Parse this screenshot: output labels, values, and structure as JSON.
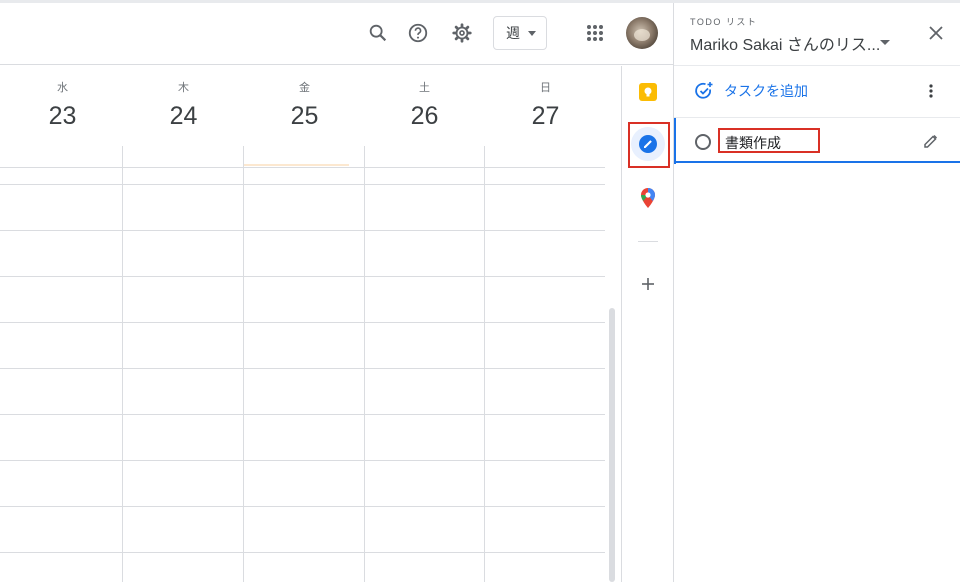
{
  "header": {
    "view_select_label": "週",
    "icons": [
      "search-icon",
      "help-icon",
      "settings-icon",
      "apps-grid-icon"
    ]
  },
  "calendar": {
    "days": [
      {
        "name": "水",
        "number": "23"
      },
      {
        "name": "木",
        "number": "24"
      },
      {
        "name": "金",
        "number": "25"
      },
      {
        "name": "土",
        "number": "26"
      },
      {
        "name": "日",
        "number": "27"
      }
    ]
  },
  "side_rail": {
    "items": [
      "keep-icon",
      "tasks-icon",
      "maps-icon",
      "add-icon"
    ],
    "active": "tasks-icon"
  },
  "tasks_panel": {
    "subtitle": "TODO リスト",
    "title": "Mariko Sakai さんのリス...",
    "add_task_label": "タスクを追加",
    "tasks": [
      {
        "title": "書類作成",
        "completed": false
      }
    ]
  },
  "colors": {
    "accent": "#1a73e8",
    "highlight_box": "#d93025",
    "keep_yellow": "#fbbc04"
  }
}
